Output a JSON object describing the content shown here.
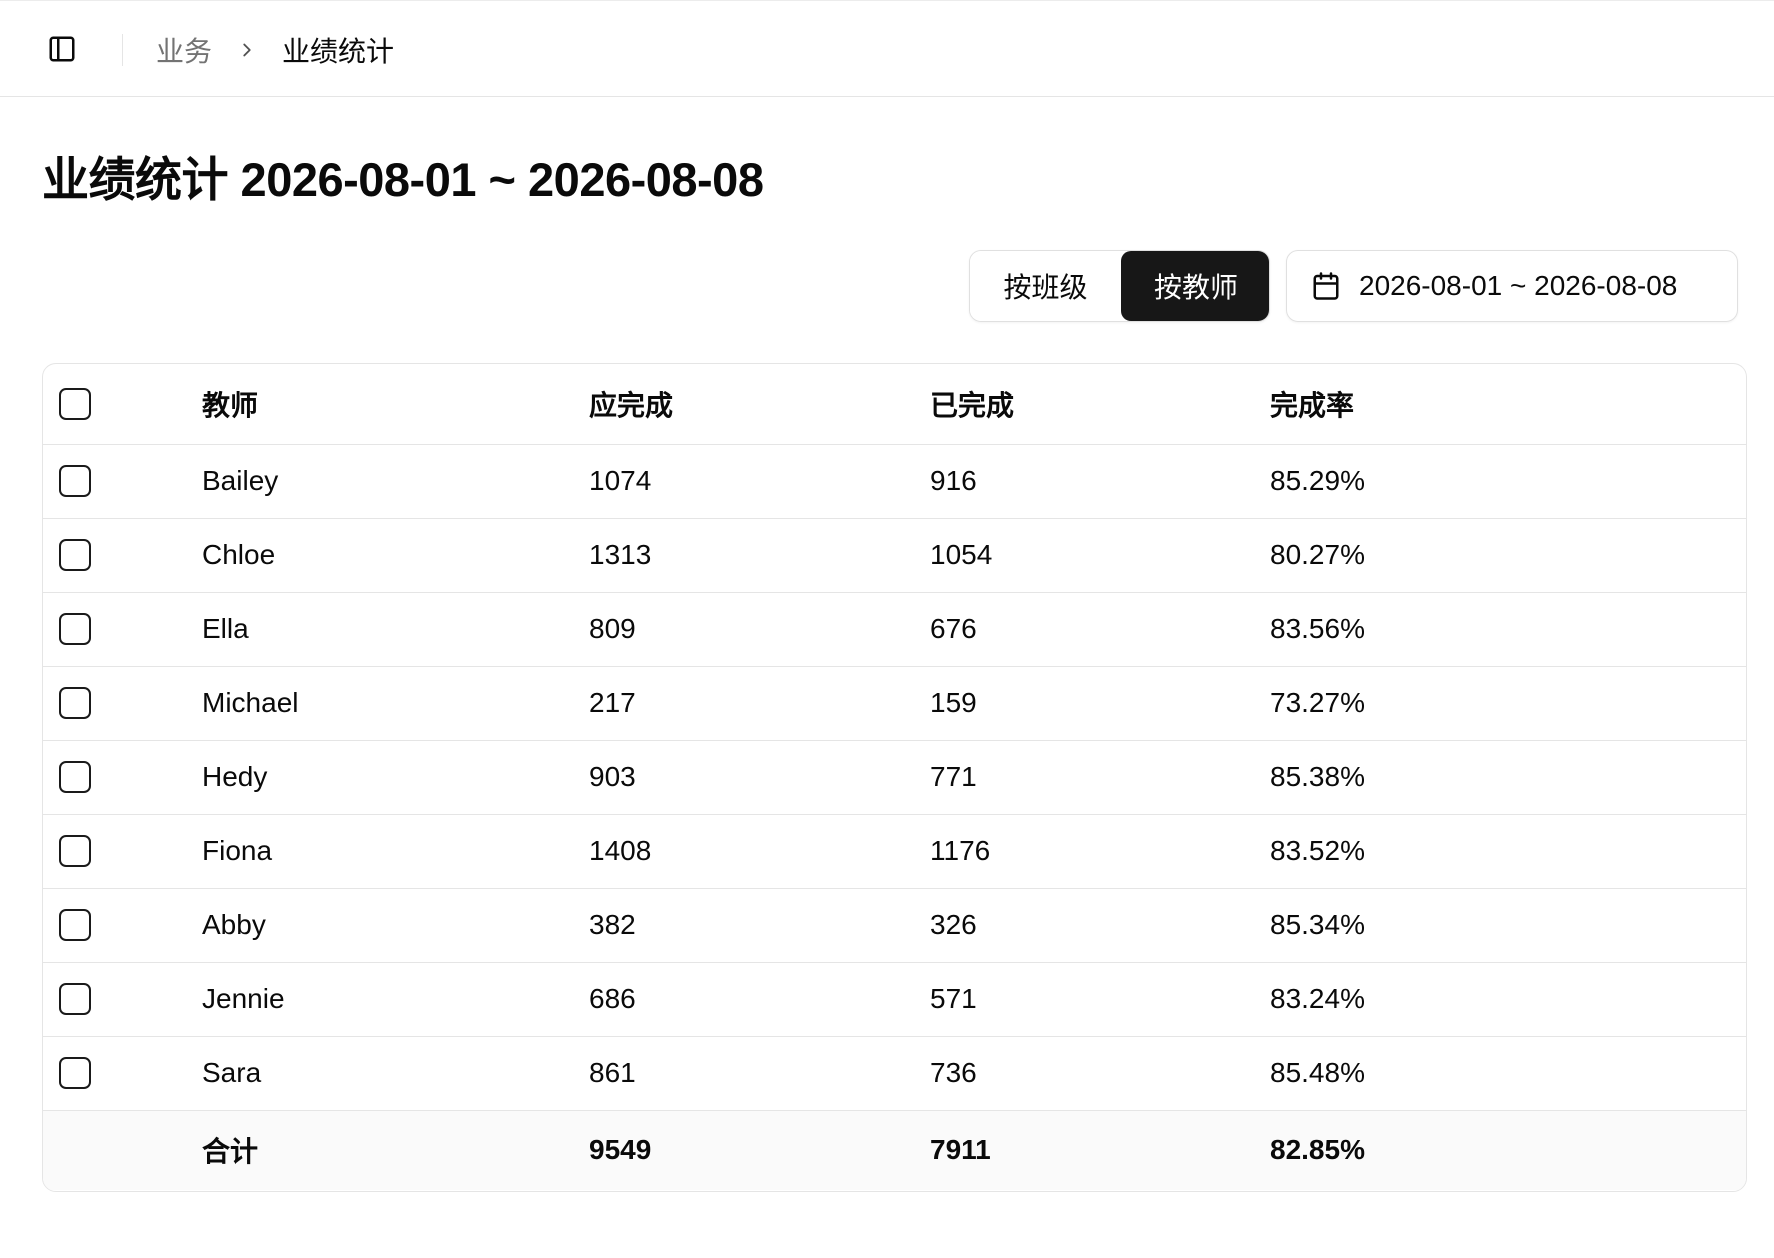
{
  "breadcrumb": {
    "parent": "业务",
    "current": "业绩统计"
  },
  "icons": {
    "sidebar_toggle": "sidebar-panel-icon",
    "separator": "chevron-right-icon",
    "calendar": "calendar-icon"
  },
  "page": {
    "title": "业绩统计 2026-08-01 ~ 2026-08-08"
  },
  "toolbar": {
    "by_class_label": "按班级",
    "by_teacher_label": "按教师",
    "active_mode": "按教师",
    "date_range": "2026-08-01 ~ 2026-08-08"
  },
  "table": {
    "columns": [
      "教师",
      "应完成",
      "已完成",
      "完成率"
    ],
    "rows": [
      {
        "teacher": "Bailey",
        "due": "1074",
        "done": "916",
        "rate": "85.29%"
      },
      {
        "teacher": "Chloe",
        "due": "1313",
        "done": "1054",
        "rate": "80.27%"
      },
      {
        "teacher": "Ella",
        "due": "809",
        "done": "676",
        "rate": "83.56%"
      },
      {
        "teacher": "Michael",
        "due": "217",
        "done": "159",
        "rate": "73.27%"
      },
      {
        "teacher": "Hedy",
        "due": "903",
        "done": "771",
        "rate": "85.38%"
      },
      {
        "teacher": "Fiona",
        "due": "1408",
        "done": "1176",
        "rate": "83.52%"
      },
      {
        "teacher": "Abby",
        "due": "382",
        "done": "326",
        "rate": "85.34%"
      },
      {
        "teacher": "Jennie",
        "due": "686",
        "done": "571",
        "rate": "83.24%"
      },
      {
        "teacher": "Sara",
        "due": "861",
        "done": "736",
        "rate": "85.48%"
      }
    ],
    "total": {
      "label": "合计",
      "due": "9549",
      "done": "7911",
      "rate": "82.85%"
    }
  },
  "colors": {
    "active_segment": "#171717",
    "border": "#e5e5e5",
    "muted_text": "#737373",
    "footer_bg": "#fafafa"
  }
}
